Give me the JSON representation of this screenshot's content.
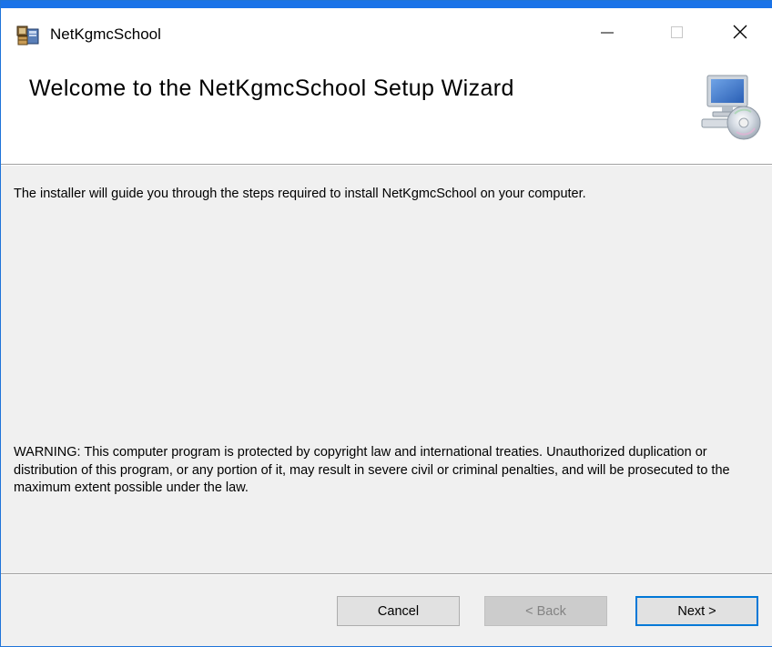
{
  "window": {
    "title": "NetKgmcSchool",
    "controls": {
      "minimize_icon": "minimize-icon",
      "maximize_icon": "maximize-icon",
      "close_icon": "close-icon"
    }
  },
  "banner": {
    "heading": "Welcome to the NetKgmcSchool Setup Wizard",
    "icon": "computer-cd-icon"
  },
  "body": {
    "intro": "The installer will guide you through the steps required to install NetKgmcSchool on your computer.",
    "warning": "WARNING: This computer program is protected by copyright law and international treaties. Unauthorized duplication or distribution of this program, or any portion of it, may result in severe civil or criminal penalties, and will be prosecuted to the maximum extent possible under the law."
  },
  "buttons": {
    "cancel": "Cancel",
    "back": "< Back",
    "next": "Next >"
  },
  "colors": {
    "accent": "#1a73e8",
    "dialog_bg": "#f0f0f0",
    "button_bg": "#e1e1e1",
    "focus_border": "#0078d7",
    "disabled_text": "#838383"
  }
}
